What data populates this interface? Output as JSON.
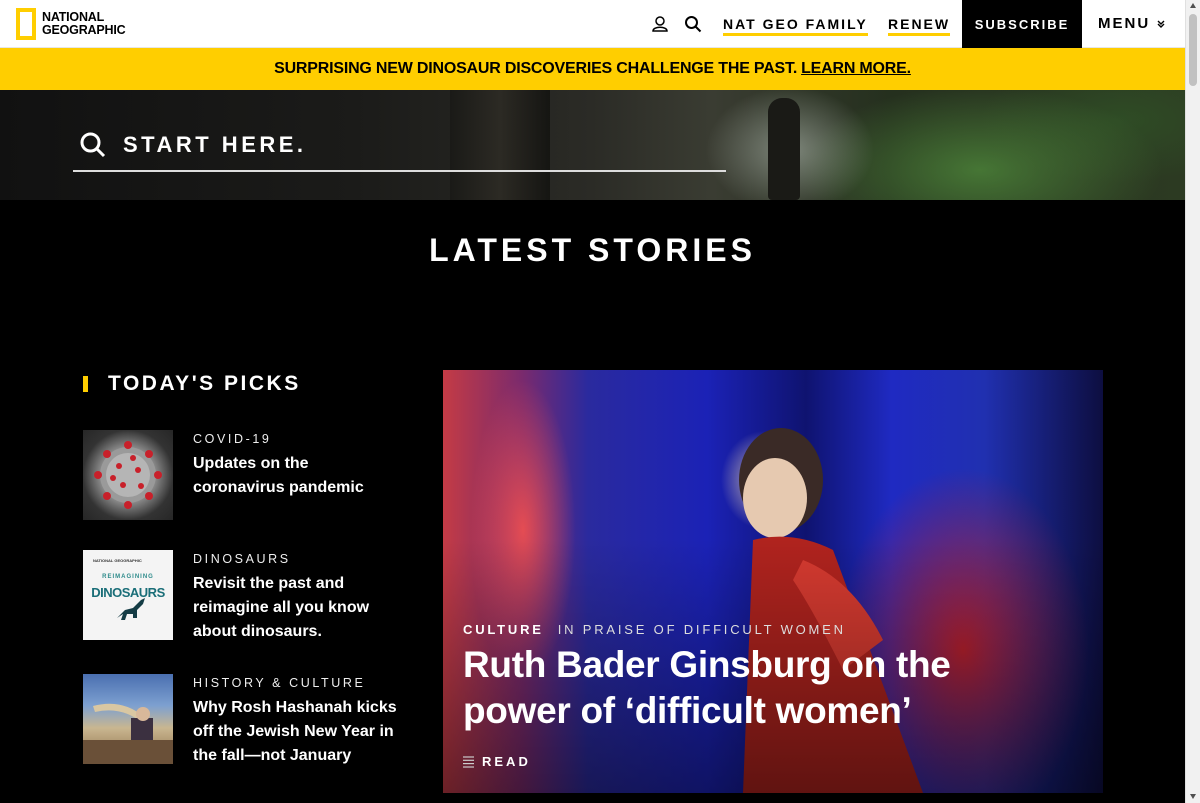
{
  "header": {
    "logo_line1": "NATIONAL",
    "logo_line2": "GEOGRAPHIC",
    "nat_geo_family": "NAT GEO FAMILY",
    "renew": "RENEW",
    "subscribe": "SUBSCRIBE",
    "menu": "MENU",
    "icons": [
      "user-icon",
      "search-icon",
      "chevron-down-icon"
    ],
    "accent_color": "#ffce00"
  },
  "banner": {
    "text": "SURPRISING NEW DINOSAUR DISCOVERIES CHALLENGE THE PAST.",
    "link": "LEARN MORE."
  },
  "search": {
    "placeholder": "START HERE."
  },
  "latest": {
    "heading": "LATEST STORIES"
  },
  "picks": {
    "heading": "TODAY'S PICKS",
    "items": [
      {
        "category": "COVID-19",
        "title": "Updates on the coronavirus pandemic"
      },
      {
        "category": "DINOSAURS",
        "title": "Revisit the past and reimagine all you know about dinosaurs.",
        "thumb_text_top": "NATIONAL GEOGRAPHIC",
        "thumb_text_mid": "REIMAGINING",
        "thumb_text_big": "DINOSAURS"
      },
      {
        "category": "HISTORY & CULTURE",
        "title": "Why Rosh Hashanah kicks off the Jewish New Year in the fall—not January"
      }
    ]
  },
  "feature": {
    "category": "CULTURE",
    "series": "IN PRAISE OF DIFFICULT WOMEN",
    "title": "Ruth Bader Ginsburg on the power of ‘difficult women’",
    "read": "READ"
  }
}
